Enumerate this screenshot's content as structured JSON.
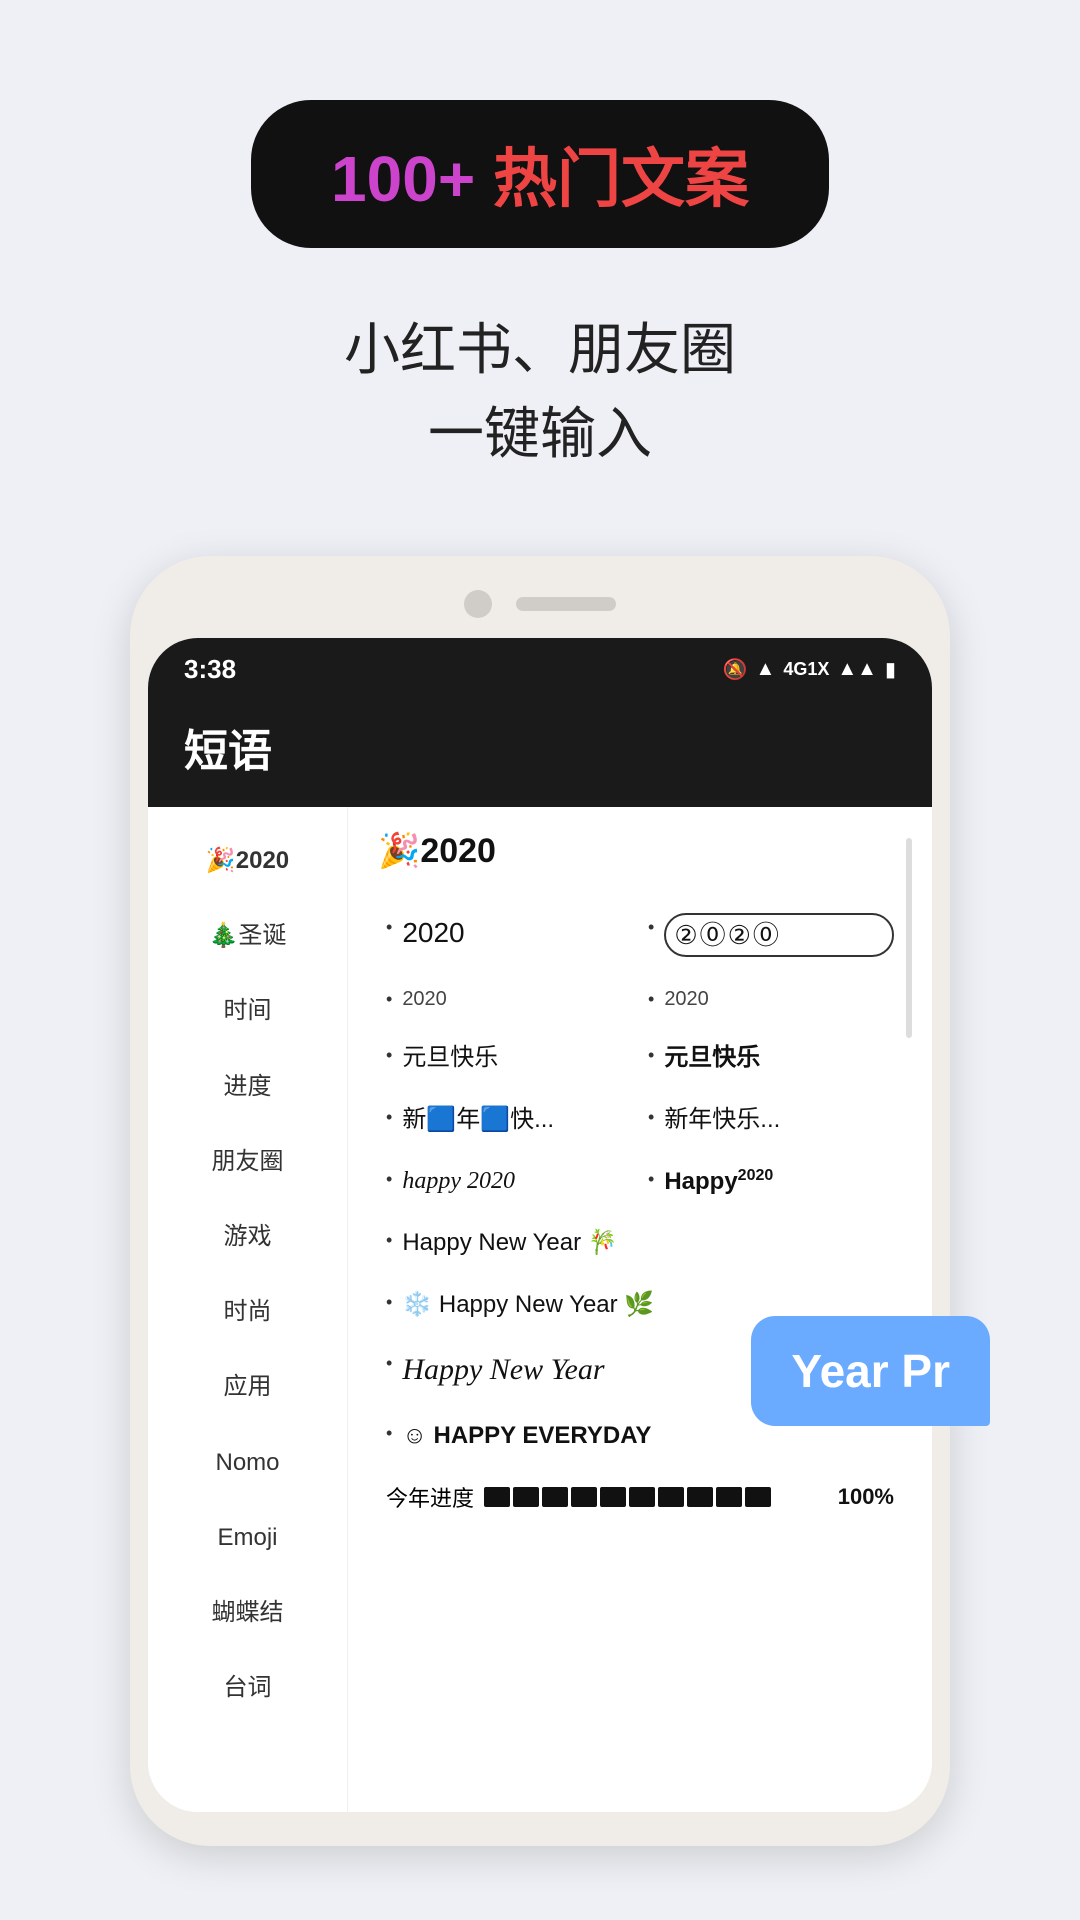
{
  "promo": {
    "badge": {
      "part1": "100+ ",
      "part2": "热门文案"
    },
    "subtitle_line1": "小红书、朋友圈",
    "subtitle_line2": "一键输入"
  },
  "status_bar": {
    "time": "3:38",
    "icons": "🔕 📶 4G 📶 🔋"
  },
  "app_header": {
    "title": "短语"
  },
  "sidebar": {
    "items": [
      {
        "label": "🎉2020",
        "active": true
      },
      {
        "label": "🎄圣诞",
        "active": false
      },
      {
        "label": "时间",
        "active": false
      },
      {
        "label": "进度",
        "active": false
      },
      {
        "label": "朋友圈",
        "active": false
      },
      {
        "label": "游戏",
        "active": false
      },
      {
        "label": "时尚",
        "active": false
      },
      {
        "label": "应用",
        "active": false
      },
      {
        "label": "Nomo",
        "active": false
      },
      {
        "label": "Emoji",
        "active": false
      },
      {
        "label": "蝴蝶结",
        "active": false
      },
      {
        "label": "台词",
        "active": false
      }
    ]
  },
  "main": {
    "category": "🎉2020",
    "items": [
      {
        "col": 1,
        "text": "2020",
        "style": "normal"
      },
      {
        "col": 2,
        "text": "②⓪②⓪",
        "style": "circled"
      },
      {
        "col": 1,
        "text": "2020",
        "style": "small"
      },
      {
        "col": 2,
        "text": "2020",
        "style": "small"
      },
      {
        "col": 1,
        "text": "元旦快乐",
        "style": "normal"
      },
      {
        "col": 2,
        "text": "元旦快乐",
        "style": "bold"
      },
      {
        "col": 1,
        "text": "新🟦年🟦快...",
        "style": "normal"
      },
      {
        "col": 2,
        "text": "新年快乐...",
        "style": "normal"
      },
      {
        "col": 1,
        "text": "happy 2020",
        "style": "italic"
      },
      {
        "col": 2,
        "text": "Happy 2020",
        "style": "bold-mix"
      },
      {
        "full": true,
        "text": "Happy New Year 🎋",
        "style": "normal"
      },
      {
        "full": true,
        "text": "❄️ Happy New Year 🌿",
        "style": "normal"
      },
      {
        "full": true,
        "text": "Happy New Year",
        "style": "script"
      },
      {
        "full": true,
        "text": "☺ HAPPY EVERYDAY",
        "style": "caps"
      },
      {
        "progress": true,
        "blocks": 10,
        "percent": "100%"
      }
    ]
  },
  "speech_bubble": {
    "text": "Year Pr"
  }
}
